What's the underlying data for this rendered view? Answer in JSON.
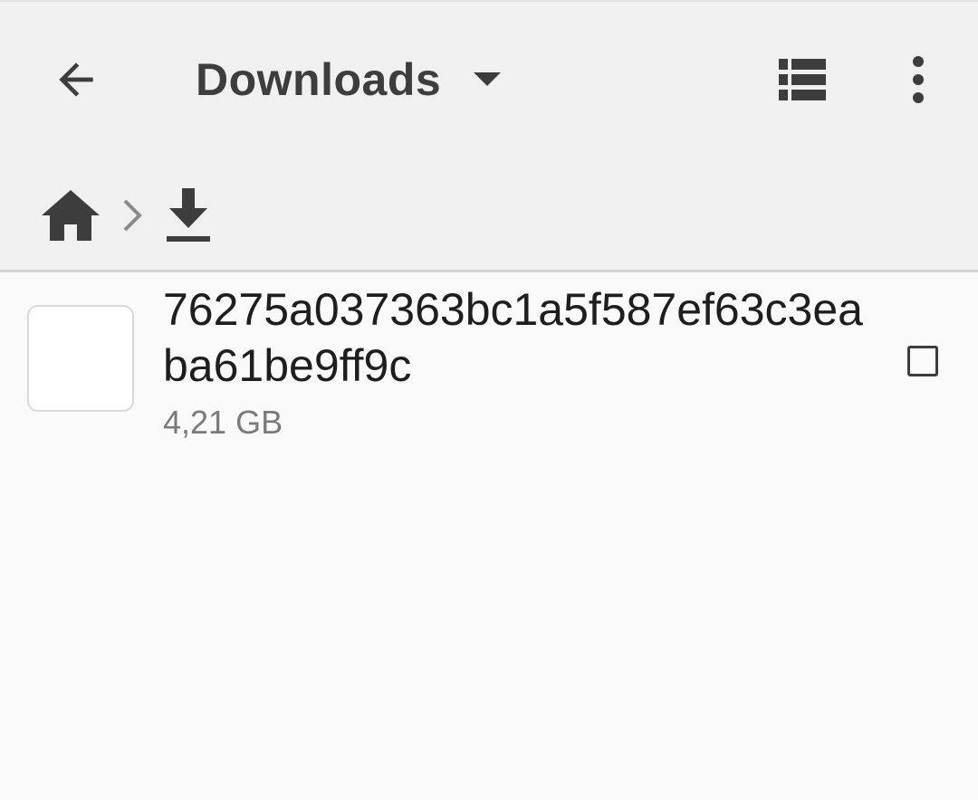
{
  "toolbar": {
    "title": "Downloads",
    "back_icon": "arrow-back-icon",
    "dropdown_icon": "dropdown-arrow-icon",
    "view_icon": "list-view-icon",
    "more_icon": "more-vert-icon"
  },
  "breadcrumb": {
    "items": [
      {
        "icon": "home-icon"
      },
      {
        "icon": "download-icon"
      }
    ],
    "separator_icon": "chevron-right-icon"
  },
  "files": [
    {
      "name": "76275a037363bc1a5f587ef63c3eaba61be9ff9c",
      "size": "4,21 GB",
      "checked": false
    }
  ],
  "colors": {
    "toolbar_bg": "#f0f0f0",
    "content_bg": "#fafafa",
    "icon": "#3d3d3d",
    "secondary_text": "#7a7a7a"
  }
}
